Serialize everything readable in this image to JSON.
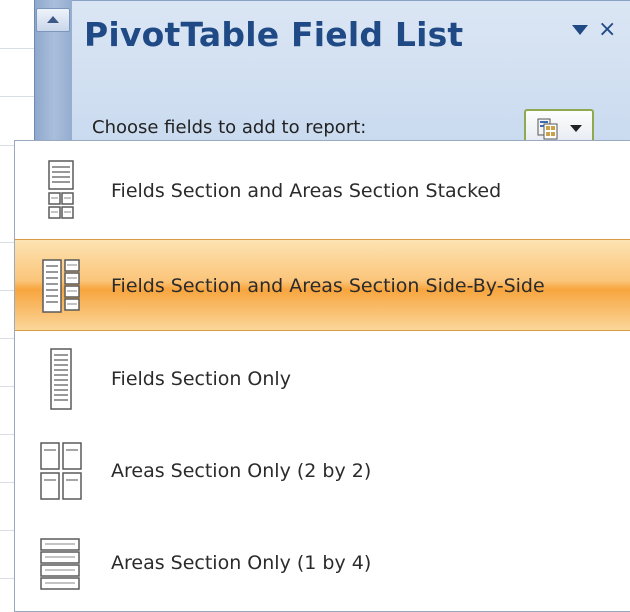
{
  "pane": {
    "title": "PivotTable Field List",
    "choose_label": "Choose fields to add to report:"
  },
  "menu": {
    "items": [
      {
        "label": "Fields Section and Areas Section Stacked",
        "icon": "fields-areas-stacked-icon",
        "selected": false
      },
      {
        "label": "Fields Section and Areas Section Side-By-Side",
        "icon": "fields-areas-side-by-side-icon",
        "selected": true
      },
      {
        "label": "Fields Section Only",
        "icon": "fields-only-icon",
        "selected": false
      },
      {
        "label": "Areas Section Only (2 by 2)",
        "icon": "areas-2by2-icon",
        "selected": false
      },
      {
        "label": "Areas Section Only (1 by 4)",
        "icon": "areas-1by4-icon",
        "selected": false
      }
    ]
  },
  "colors": {
    "title": "#1f4a86",
    "highlight": "#f7a53e",
    "pane_bg": "#c9daef"
  }
}
